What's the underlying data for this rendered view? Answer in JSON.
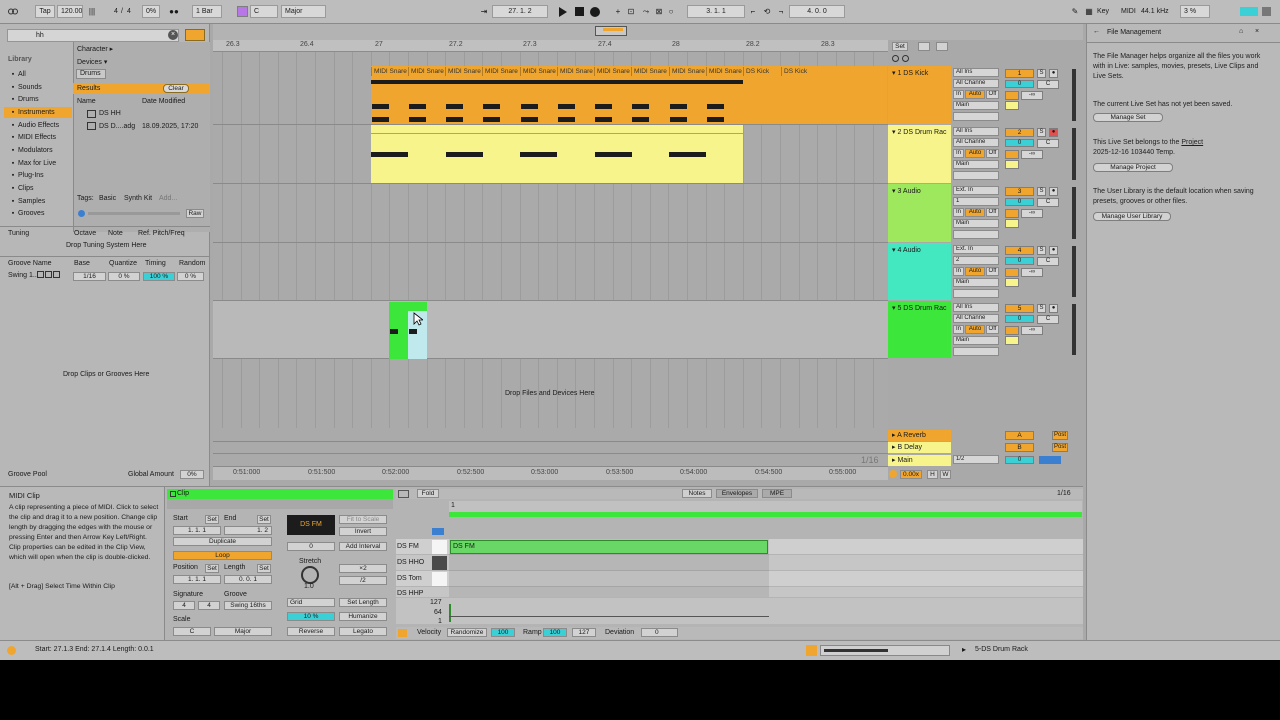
{
  "transport": {
    "tap": "Tap",
    "tempo": "120.00",
    "time_sig_num": "4",
    "time_sig_den": "4",
    "swing": "0%",
    "quantize": "1 Bar",
    "key": "C",
    "scale": "Major",
    "position": "27.  1.  2",
    "loop_start": "3.  1.  1",
    "loop_length": "4.  0.  0",
    "key_label": "Key",
    "midi_label": "MIDI",
    "sample_rate": "44.1 kHz",
    "cpu": "3 %"
  },
  "browser": {
    "search_value": "hh",
    "library_title": "Library",
    "library_items": [
      "All",
      "Sounds",
      "Drums",
      "Instruments",
      "Audio Effects",
      "MIDI Effects",
      "Modulators",
      "Max for Live",
      "Plug-Ins",
      "Clips",
      "Samples",
      "Grooves"
    ],
    "filter_character": "Character ▸",
    "filter_devices": "Devices ▾",
    "filter_drums": "Drums",
    "results_label": "Results",
    "clear_label": "Clear",
    "col_name": "Name",
    "col_date": "Date Modified",
    "results": [
      {
        "name": "DS HH",
        "date": ""
      },
      {
        "name": "DS D....adg",
        "date": "18.09.2025, 17:20"
      }
    ],
    "tags_label": "Tags:",
    "tag_basic": "Basic",
    "tag_synth": "Synth Kit",
    "tag_add": "Add...",
    "raw": "Raw"
  },
  "tuning": {
    "title": "Tuning",
    "col_octave": "Octave",
    "col_note": "Note",
    "col_ref": "Ref. Pitch/Freq",
    "drop": "Drop Tuning System Here"
  },
  "groove": {
    "col_name": "Groove Name",
    "col_base": "Base",
    "col_quantize": "Quantize",
    "col_timing": "Timing",
    "col_random": "Random",
    "row_name": "Swing 1...",
    "row_base": "1/16",
    "row_quantize": "0 %",
    "row_timing": "100 %",
    "row_random": "0 %",
    "drop": "Drop Clips or Grooves Here",
    "pool": "Groove Pool",
    "global_amount": "Global Amount",
    "global_value": "0%"
  },
  "ruler": {
    "bars": [
      "26.3",
      "26.4",
      "27",
      "27.2",
      "27.3",
      "27.4",
      "28",
      "28.2",
      "28.3"
    ],
    "times": [
      "0:51:000",
      "0:51:500",
      "0:52:000",
      "0:52:500",
      "0:53:000",
      "0:53:500",
      "0:54:000",
      "0:54:500",
      "0:55:000"
    ],
    "set_label": "Set",
    "zoom": "1/16"
  },
  "tracks": [
    {
      "name": "1 DS Kick",
      "input": "All Ins",
      "channel": "All Channe",
      "monitor_in": "In",
      "monitor_auto": "Auto",
      "monitor_off": "Off",
      "output": "Main",
      "number": "1",
      "vol": "0",
      "pan": "C",
      "sends": "-∞",
      "color": "#f0a62e"
    },
    {
      "name": "2 DS Drum Rac",
      "input": "All Ins",
      "channel": "All Channe",
      "monitor_in": "In",
      "monitor_auto": "Auto",
      "monitor_off": "Off",
      "output": "Main",
      "number": "2",
      "vol": "0",
      "pan": "C",
      "sends": "-∞",
      "color": "#f6f48a"
    },
    {
      "name": "3 Audio",
      "input": "Ext. In",
      "channel": "1",
      "monitor_in": "In",
      "monitor_auto": "Auto",
      "monitor_off": "Off",
      "output": "Main",
      "number": "3",
      "vol": "0",
      "pan": "C",
      "sends": "-∞",
      "color": "#9ee85e"
    },
    {
      "name": "4 Audio",
      "input": "Ext. In",
      "channel": "2",
      "monitor_in": "In",
      "monitor_auto": "Auto",
      "monitor_off": "Off",
      "output": "Main",
      "number": "4",
      "vol": "0",
      "pan": "C",
      "sends": "-∞",
      "color": "#44e8c0"
    },
    {
      "name": "5 DS Drum Rac",
      "input": "All Ins",
      "channel": "All Channe",
      "monitor_in": "In",
      "monitor_auto": "Auto",
      "monitor_off": "Off",
      "output": "Main",
      "number": "5",
      "vol": "0",
      "pan": "C",
      "sends": "-∞",
      "color": "#3de63a"
    }
  ],
  "clips": {
    "midi_snare": "MIDI Snare",
    "ds_kick": "DS Kick"
  },
  "returns": [
    {
      "name": "A Reverb",
      "letter": "A",
      "color": "#f0a62e"
    },
    {
      "name": "B Delay",
      "letter": "B",
      "color": "#f6f48a"
    },
    {
      "name": "Main",
      "letter": "",
      "output": "1/2",
      "color": "#f6f48a"
    }
  ],
  "arrangement": {
    "drop": "Drop Files and Devices Here",
    "tempo_master": "0.00x",
    "h_label": "H",
    "w_label": "W"
  },
  "help": {
    "title": "File Management",
    "p1": "The File Manager helps organize all the files you work with in Live: samples, movies, presets, Live Clips and Live Sets.",
    "p2": "The current Live Set has not yet been saved.",
    "btn_manage_set": "Manage Set",
    "p3_prefix": "This Live Set belongs to the",
    "p3_link": "Project",
    "p3_suffix": "2025-12-16 103440 Temp.",
    "btn_manage_project": "Manage Project",
    "p4": "The User Library is the default location when saving presets, grooves or other files.",
    "btn_manage_library": "Manage User Library"
  },
  "info": {
    "title": "MIDI Clip",
    "body": "A clip representing a piece of MIDI. Click to select the clip and drag it to a new position. Change clip length by dragging the edges with the mouse or pressing Enter and then Arrow Key Left/Right. Clip properties can be edited in the Clip View, which will open when the clip is double-clicked.",
    "hint": "[Alt + Drag] Select Time Within Clip"
  },
  "clip_view": {
    "tab_clip": "Clip",
    "start_label": "Start",
    "end_label": "End",
    "set": "Set",
    "start_value": "1.   1.   1",
    "end_value": "1.   2",
    "duplicate": "Duplicate",
    "loop": "Loop",
    "position_label": "Position",
    "length_label": "Length",
    "position_value": "1.   1.   1",
    "length_value": "0.   0.   1",
    "signature_label": "Signature",
    "groove_label": "Groove",
    "sig_num": "4",
    "sig_den": "4",
    "groove_value": "Swing 16ths",
    "scale_label": "Scale",
    "scale_key": "C",
    "scale_mode": "Major",
    "clip_name": "DS FM",
    "fit_to_scale": "Fit to Scale",
    "invert": "Invert",
    "transpose": "0",
    "add_interval": "Add Interval",
    "stretch_label": "Stretch",
    "stretch_value": "1.0",
    "x2": "×2",
    "div2": "/2",
    "grid": "Grid",
    "set_length": "Set Length",
    "humanize_amount": "10 %",
    "humanize": "Humanize",
    "reverse": "Reverse",
    "legato": "Legato"
  },
  "editor": {
    "fold": "Fold",
    "tab_notes": "Notes",
    "tab_envelopes": "Envelopes",
    "tab_mpe": "MPE",
    "grid": "1/16",
    "bar_marker": "1",
    "lanes": [
      "DS FM",
      "DS HHO",
      "DS Tom",
      "DS HHP"
    ],
    "note_label": "DS FM",
    "vel_max": "127",
    "vel_mid": "64",
    "vel_min": "1",
    "velocity_label": "Velocity",
    "randomize": "Randomize",
    "velocity_value": "100",
    "ramp_label": "Ramp",
    "ramp_from": "100",
    "ramp_to": "127",
    "deviation_label": "Deviation",
    "deviation_value": "0"
  },
  "status": {
    "selection": "Start: 27.1.3  End: 27.1.4  Length: 0.0.1",
    "track": "5-DS Drum Rack"
  }
}
